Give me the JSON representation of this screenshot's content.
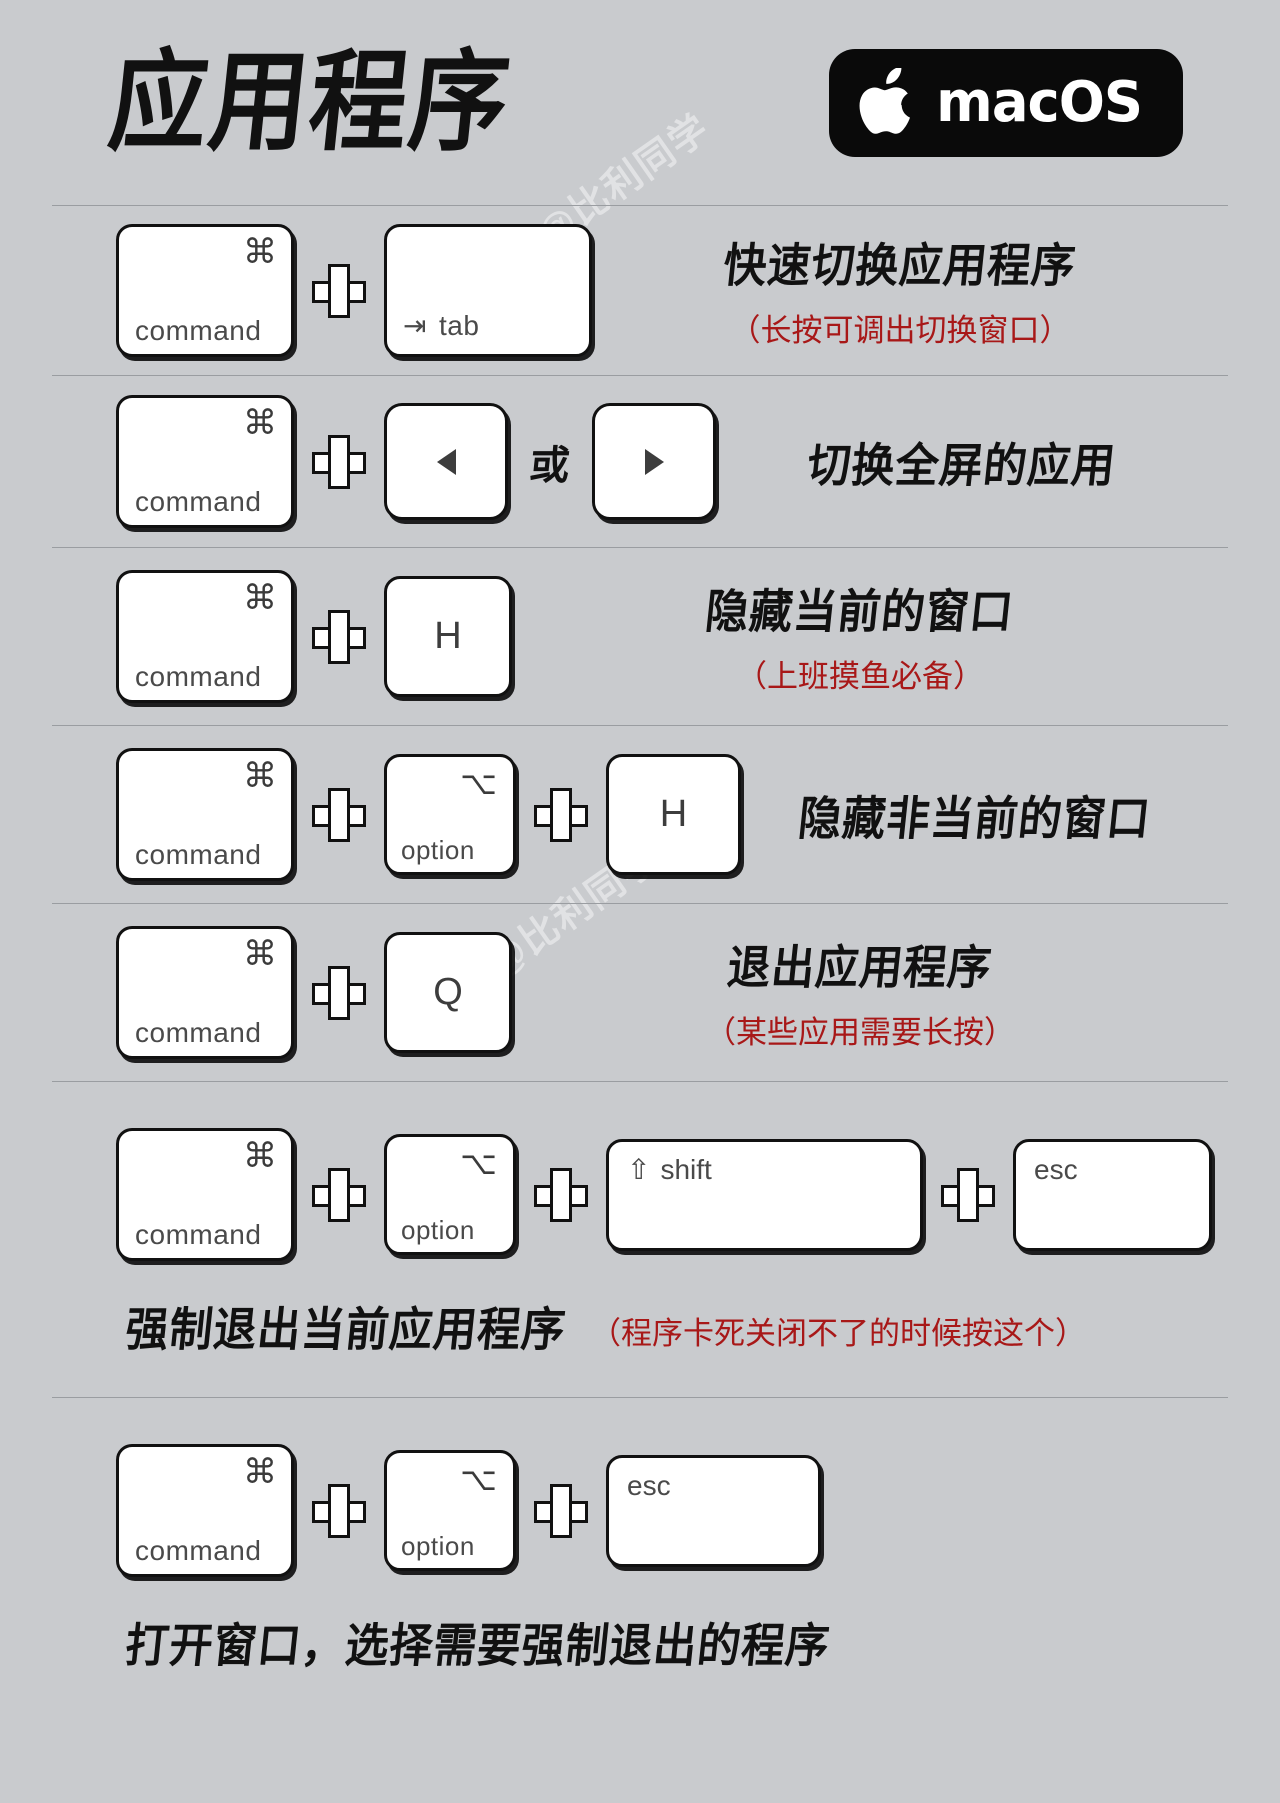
{
  "header": {
    "title": "应用程序",
    "os_badge": {
      "name": "macOS",
      "icon": "apple-logo-icon",
      "bg": "#0a0a0a",
      "fg": "#ffffff"
    }
  },
  "watermark": {
    "text": "@比利同学"
  },
  "colors": {
    "background": "#c9cbce",
    "divider": "#9a9da1",
    "key_face": "#ffffff",
    "key_border": "#111111",
    "text_primary": "#111111",
    "text_note": "#a81818",
    "key_label": "#4a4a4a"
  },
  "key_labels": {
    "command": "command",
    "command_symbol": "⌘",
    "tab": "tab",
    "tab_symbol": "⇥",
    "option": "option",
    "option_symbol": "⌥",
    "shift": "shift",
    "shift_symbol": "⇧",
    "esc": "esc",
    "h": "H",
    "q": "Q",
    "arrow_left": "◀",
    "arrow_right": "▶",
    "plus": "+",
    "or": "或"
  },
  "rows": [
    {
      "id": "switch-apps",
      "keys": [
        "command",
        "tab"
      ],
      "desc": "快速切换应用程序",
      "note": "（长按可调出切换窗口）"
    },
    {
      "id": "switch-fullscreen",
      "keys": [
        "command",
        "arrow-left",
        "arrow-right"
      ],
      "desc": "切换全屏的应用",
      "note": ""
    },
    {
      "id": "hide-current-window",
      "keys": [
        "command",
        "H"
      ],
      "desc": "隐藏当前的窗口",
      "note": "（上班摸鱼必备）"
    },
    {
      "id": "hide-other-windows",
      "keys": [
        "command",
        "option",
        "H"
      ],
      "desc": "隐藏非当前的窗口",
      "note": ""
    },
    {
      "id": "quit-app",
      "keys": [
        "command",
        "Q"
      ],
      "desc": "退出应用程序",
      "note": "（某些应用需要长按）"
    },
    {
      "id": "force-quit-current",
      "keys": [
        "command",
        "option",
        "shift",
        "esc"
      ],
      "desc": "强制退出当前应用程序",
      "note": "（程序卡死关闭不了的时候按这个）"
    },
    {
      "id": "force-quit-window",
      "keys": [
        "command",
        "option",
        "esc"
      ],
      "desc": "打开窗口，选择需要强制退出的程序",
      "note": ""
    }
  ]
}
